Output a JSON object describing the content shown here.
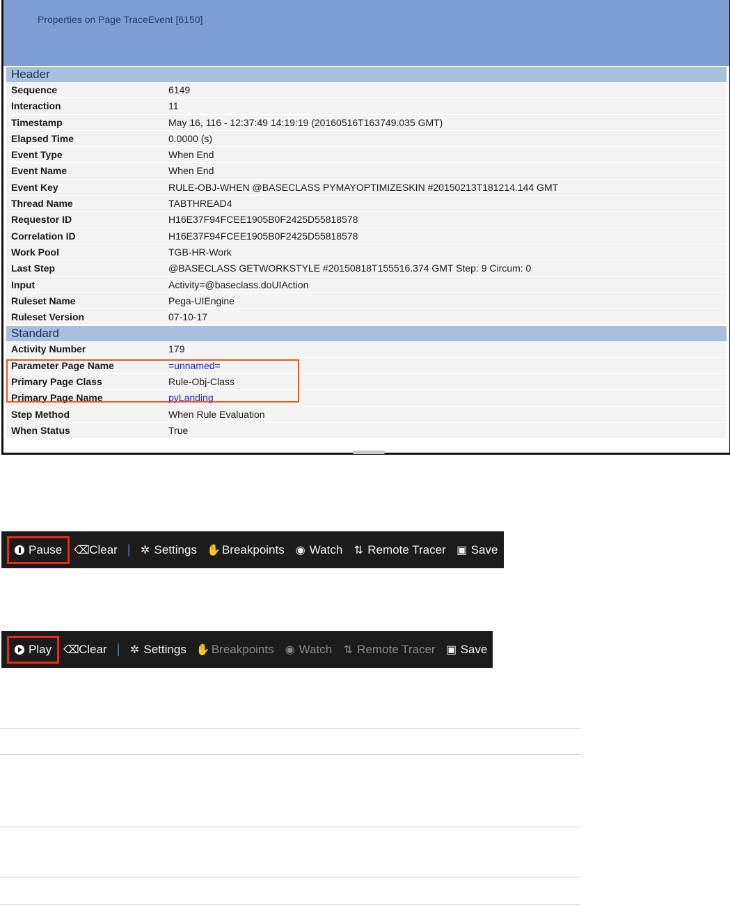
{
  "panel": {
    "title": "Properties on Page TraceEvent [6150]",
    "sections": {
      "header": "Header",
      "standard": "Standard"
    },
    "header_rows": [
      {
        "key": "Sequence",
        "value": "6149"
      },
      {
        "key": "Interaction",
        "value": "11"
      },
      {
        "key": "Timestamp",
        "value": "May 16, 116 - 12:37:49 14:19:19  (20160516T163749.035 GMT)"
      },
      {
        "key": "Elapsed Time",
        "value": "0.0000 (s)"
      },
      {
        "key": "Event Type",
        "value": "When End"
      },
      {
        "key": "Event Name",
        "value": "When End"
      },
      {
        "key": "Event Key",
        "value": "RULE-OBJ-WHEN @BASECLASS PYMAYOPTIMIZESKIN #20150213T181214.144 GMT"
      },
      {
        "key": "Thread Name",
        "value": "TABTHREAD4"
      },
      {
        "key": "Requestor ID",
        "value": "H16E37F94FCEE1905B0F2425D55818578"
      },
      {
        "key": "Correlation ID",
        "value": "H16E37F94FCEE1905B0F2425D55818578"
      },
      {
        "key": "Work Pool",
        "value": "TGB-HR-Work"
      },
      {
        "key": "Last Step",
        "value": "@BASECLASS GETWORKSTYLE #20150818T155516.374 GMT Step: 9 Circum: 0"
      },
      {
        "key": "Input",
        "value": "Activity=@baseclass.doUIAction"
      },
      {
        "key": "Ruleset Name",
        "value": "Pega-UIEngine"
      },
      {
        "key": "Ruleset Version",
        "value": "07-10-17"
      }
    ],
    "standard_rows": [
      {
        "key": "Activity Number",
        "value": "179"
      },
      {
        "key": "Parameter Page Name",
        "value": "=unnamed="
      },
      {
        "key": "Primary Page Class",
        "value": "Rule-Obj-Class"
      },
      {
        "key": "Primary Page Name",
        "value": "pyLanding"
      },
      {
        "key": "Step Method",
        "value": "When Rule Evaluation"
      },
      {
        "key": "When Status",
        "value": "True"
      }
    ],
    "colors": {
      "title_bg": "#7f9fd4",
      "section_bg": "#a9bfe0",
      "link": "#2020cc",
      "highlight": "#e85a1e"
    }
  },
  "toolbar_running": {
    "primary": "Pause",
    "clear": "Clear",
    "settings": "Settings",
    "breakpoints": "Breakpoints",
    "watch": "Watch",
    "remote_tracer": "Remote Tracer",
    "save": "Save"
  },
  "toolbar_paused": {
    "primary": "Play",
    "clear": "Clear",
    "settings": "Settings",
    "breakpoints": "Breakpoints",
    "watch": "Watch",
    "remote_tracer": "Remote Tracer",
    "save": "Save"
  },
  "toolbar_colors": {
    "bg": "#1c1c1c",
    "disabled_text": "#8a8a8a",
    "primary_border": "#e82b12"
  }
}
